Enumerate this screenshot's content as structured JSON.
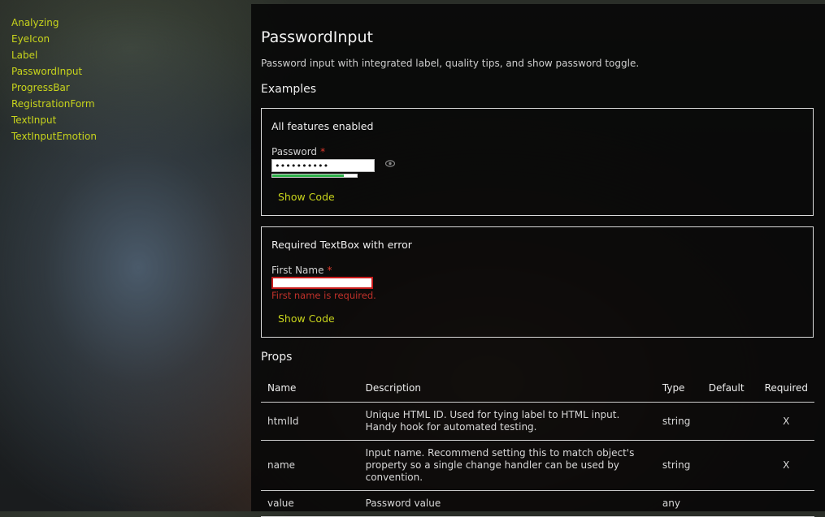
{
  "sidebar": {
    "items": [
      "Analyzing",
      "EyeIcon",
      "Label",
      "PasswordInput",
      "ProgressBar",
      "RegistrationForm",
      "TextInput",
      "TextInputEmotion"
    ]
  },
  "page": {
    "title": "PasswordInput",
    "description": "Password input with integrated label, quality tips, and show password toggle.",
    "examples_heading": "Examples",
    "props_heading": "Props"
  },
  "examples": [
    {
      "title": "All features enabled",
      "field_label": "Password",
      "required_mark": "*",
      "value": "••••••••••",
      "quality_percent": 85,
      "show_code": "Show Code"
    },
    {
      "title": "Required TextBox with error",
      "field_label": "First Name",
      "required_mark": "*",
      "error": "First name is required.",
      "show_code": "Show Code"
    }
  ],
  "props": {
    "headers": [
      "Name",
      "Description",
      "Type",
      "Default",
      "Required"
    ],
    "rows": [
      {
        "name": "htmlId",
        "description": "Unique HTML ID. Used for tying label to HTML input. Handy hook for automated testing.",
        "type": "string",
        "default": "",
        "required": "X"
      },
      {
        "name": "name",
        "description": "Input name. Recommend setting this to match object's property so a single change handler can be used by convention.",
        "type": "string",
        "default": "",
        "required": "X"
      },
      {
        "name": "value",
        "description": "Password value",
        "type": "any",
        "default": "",
        "required": ""
      }
    ]
  },
  "colors": {
    "link": "#c8d41c",
    "required": "#e23b2e",
    "error": "#c0312a",
    "quality": "#2eb34a"
  },
  "icons": {
    "toggle": "eye-icon"
  }
}
